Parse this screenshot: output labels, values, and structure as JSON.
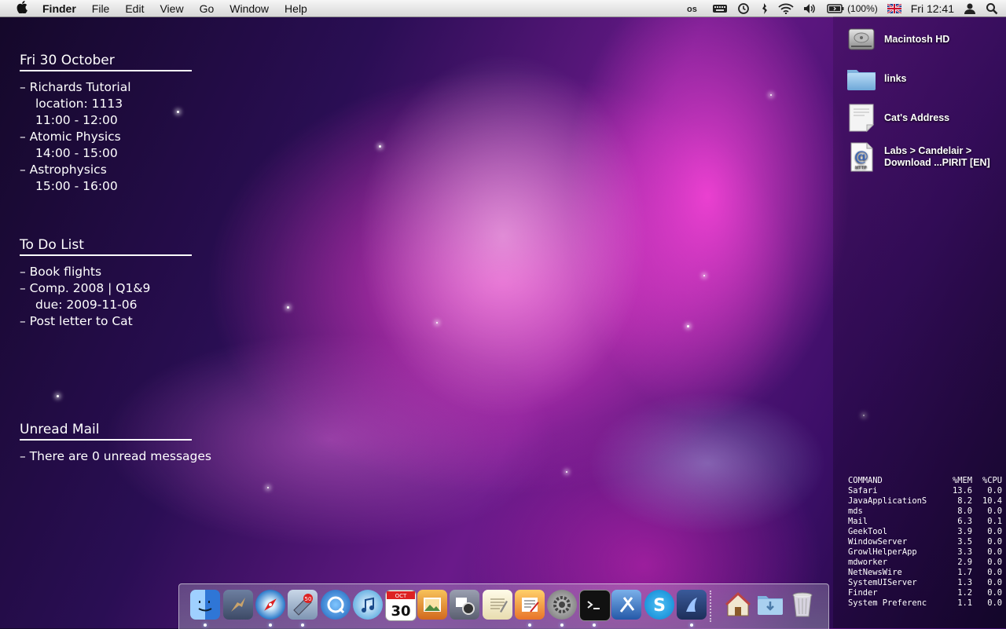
{
  "menubar": {
    "apple_glyph": "",
    "items": [
      "Finder",
      "File",
      "Edit",
      "View",
      "Go",
      "Window",
      "Help"
    ],
    "status": {
      "battery": "(100%)",
      "clock": "Fri 12:41"
    }
  },
  "calendar": {
    "title": "Fri 30 October",
    "lines": [
      {
        "text": "– Richards Tutorial"
      },
      {
        "text": "location: 1113"
      },
      {
        "text": "11:00 - 12:00"
      },
      {
        "text": "– Atomic Physics"
      },
      {
        "text": "14:00 - 15:00"
      },
      {
        "text": "– Astrophysics"
      },
      {
        "text": "15:00 - 16:00"
      }
    ]
  },
  "todo": {
    "title": "To Do List",
    "lines": [
      {
        "text": "– Book flights"
      },
      {
        "text": "– Comp. 2008 | Q1&9"
      },
      {
        "text": "due: 2009-11-06"
      },
      {
        "text": "– Post letter to Cat"
      }
    ]
  },
  "mail": {
    "title": "Unread Mail",
    "lines": [
      {
        "text": "– There are 0 unread messages"
      }
    ]
  },
  "desktop_items": [
    {
      "label": "Macintosh HD",
      "icon": "hard-drive-icon"
    },
    {
      "label": "links",
      "icon": "folder-icon"
    },
    {
      "label": "Cat's Address",
      "icon": "text-clipping-icon"
    },
    {
      "label_line1": "Labs > Candelair >",
      "label_line2": "Download ...PIRIT [EN]",
      "icon": "webloc-icon"
    }
  ],
  "processes": {
    "headers": [
      "COMMAND",
      "%MEM",
      "%CPU"
    ],
    "rows": [
      [
        "Safari",
        "13.6",
        "0.0"
      ],
      [
        "JavaApplicationS",
        "8.2",
        "10.4"
      ],
      [
        "mds",
        "8.0",
        "0.0"
      ],
      [
        "Mail",
        "6.3",
        "0.1"
      ],
      [
        "GeekTool",
        "3.9",
        "0.0"
      ],
      [
        "WindowServer",
        "3.5",
        "0.0"
      ],
      [
        "GrowlHelperApp",
        "3.3",
        "0.0"
      ],
      [
        "mdworker",
        "2.9",
        "0.0"
      ],
      [
        "NetNewsWire",
        "1.7",
        "0.0"
      ],
      [
        "SystemUIServer",
        "1.3",
        "0.0"
      ],
      [
        "Finder",
        "1.2",
        "0.0"
      ],
      [
        "System Preferenc",
        "1.1",
        "0.0"
      ]
    ]
  },
  "dock": {
    "calendar_month": "OCT",
    "calendar_day": "30",
    "mail_badge": "50",
    "apps": [
      {
        "icon": "finder-icon",
        "running": true
      },
      {
        "icon": "preview-bird-icon",
        "running": false
      },
      {
        "icon": "safari-icon",
        "running": true
      },
      {
        "icon": "mail-icon",
        "running": true
      },
      {
        "icon": "quicktime-icon",
        "running": false
      },
      {
        "icon": "itunes-icon",
        "running": false
      },
      {
        "icon": "ical-icon",
        "running": false
      },
      {
        "icon": "iphoto-icon",
        "running": false
      },
      {
        "icon": "photo-booth-icon",
        "running": false
      },
      {
        "icon": "textedit-icon",
        "running": false
      },
      {
        "icon": "netnewswire-icon",
        "running": true
      },
      {
        "icon": "system-preferences-icon",
        "running": true
      },
      {
        "icon": "terminal-icon",
        "running": true
      },
      {
        "icon": "xcode-icon",
        "running": false
      },
      {
        "icon": "skype-icon",
        "running": false
      },
      {
        "icon": "java-app-icon",
        "running": true
      }
    ],
    "right": [
      {
        "icon": "home-folder-icon"
      },
      {
        "icon": "downloads-folder-icon"
      },
      {
        "icon": "trash-icon"
      }
    ]
  }
}
